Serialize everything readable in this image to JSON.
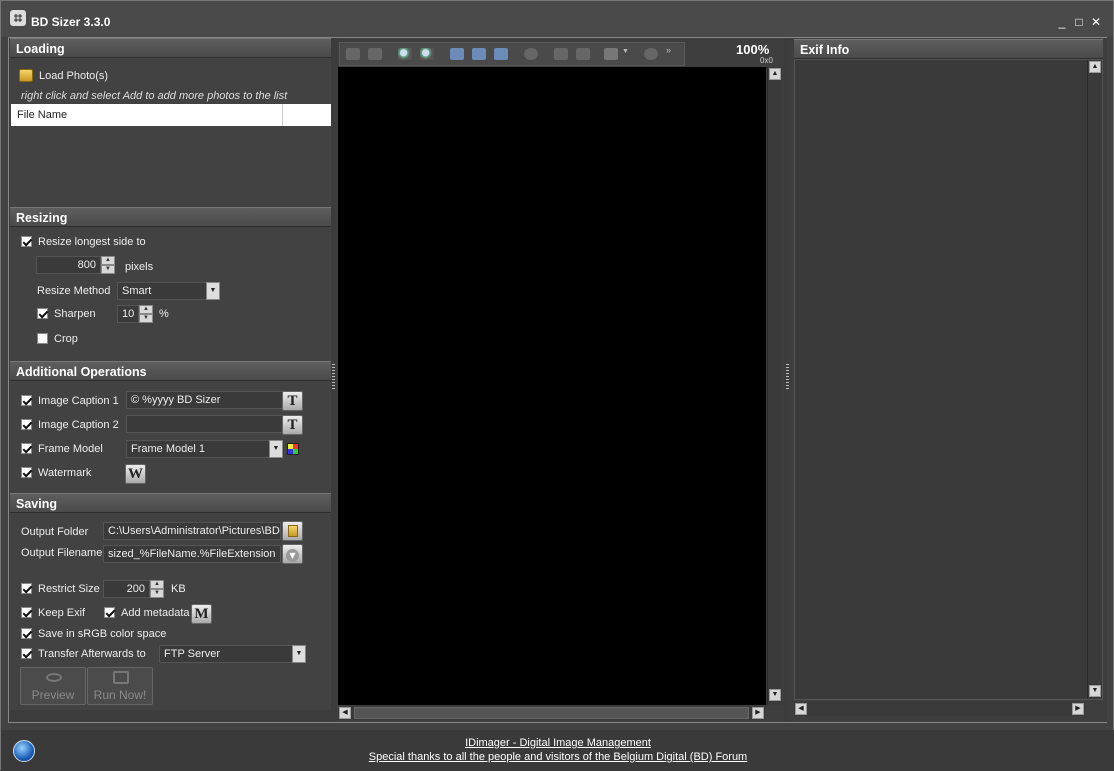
{
  "window": {
    "title": "BD Sizer 3.3.0",
    "minimize": "_",
    "maximize": "□",
    "close": "✕"
  },
  "loading": {
    "header": "Loading",
    "load_label": "Load Photo(s)",
    "hint": "right click and select Add to add more photos to the list",
    "column": "File Name"
  },
  "resizing": {
    "header": "Resizing",
    "resize_label": "Resize longest side to",
    "resize_checked": true,
    "size_value": "800",
    "size_unit": "pixels",
    "method_label": "Resize Method",
    "method_value": "Smart",
    "sharpen_label": "Sharpen",
    "sharpen_checked": true,
    "sharpen_value": "10",
    "sharpen_unit": "%",
    "crop_label": "Crop",
    "crop_checked": false
  },
  "additional": {
    "header": "Additional Operations",
    "caption1_label": "Image Caption 1",
    "caption1_value": "© %yyyy BD Sizer",
    "caption2_label": "Image Caption 2",
    "caption2_value": "",
    "frame_label": "Frame Model",
    "frame_value": "Frame Model 1",
    "watermark_label": "Watermark",
    "text_btn": "T",
    "watermark_btn": "W"
  },
  "saving": {
    "header": "Saving",
    "folder_label": "Output Folder",
    "folder_value": "C:\\Users\\Administrator\\Pictures\\BD",
    "filename_label": "Output Filename",
    "filename_value": "sized_%FileName.%FileExtension",
    "restrict_label": "Restrict Size",
    "restrict_value": "200",
    "restrict_unit": "KB",
    "keepexif_label": "Keep Exif",
    "metadata_label": "Add metadata",
    "metadata_btn": "M",
    "srgb_label": "Save in sRGB color space",
    "transfer_label": "Transfer Afterwards to",
    "transfer_value": "FTP Server",
    "preview_btn": "Preview",
    "run_btn": "Run Now!"
  },
  "viewer": {
    "zoom": "100%",
    "dimensions": "0x0"
  },
  "exif": {
    "header": "Exif Info"
  },
  "footer": {
    "link1": "IDimager - Digital Image Management",
    "link2": "Special thanks to all the people and visitors of the Belgium Digital (BD) Forum"
  }
}
